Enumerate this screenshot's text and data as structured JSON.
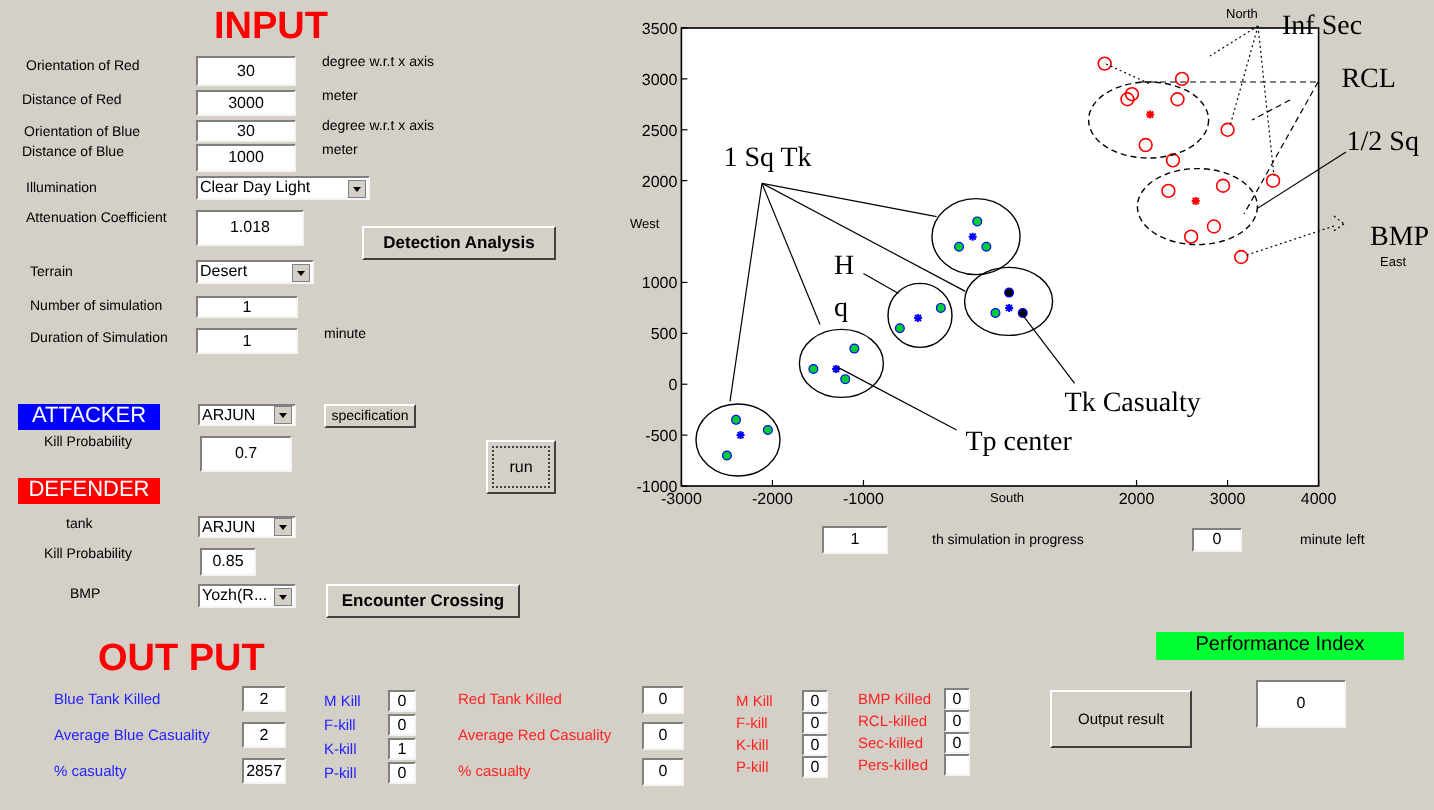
{
  "input": {
    "title": "INPUT",
    "fields": [
      {
        "kind": "edit",
        "label": "Orientation of Red",
        "value": "30",
        "unit": "degree w.r.t  x axis"
      },
      {
        "kind": "edit",
        "label": "Distance of Red",
        "value": "3000",
        "unit": "meter"
      },
      {
        "kind": "edit",
        "label": "Orientation of Blue",
        "value": "30",
        "unit": "degree w.r.t  x axis"
      },
      {
        "kind": "edit",
        "label": "Distance of Blue",
        "value": "1000",
        "unit": "meter"
      },
      {
        "kind": "dropdown",
        "label": "Illumination",
        "value": "Clear Day Light"
      },
      {
        "kind": "edit",
        "label": "Attenuation Coefficient",
        "value": "1.018"
      },
      {
        "kind": "dropdown",
        "label": "Terrain",
        "value": "Desert"
      },
      {
        "kind": "edit",
        "label": "Number of simulation",
        "value": "1"
      },
      {
        "kind": "edit",
        "label": "Duration of Simulation",
        "value": "1",
        "unit": "minute"
      }
    ],
    "detection_button": "Detection Analysis"
  },
  "attacker": {
    "label": "ATTACKER",
    "vehicle": "ARJUN",
    "spec_button": "specification",
    "kill_probability_label": "Kill Probability",
    "kill_probability": "0.7"
  },
  "run_button": "run",
  "defender": {
    "label": "DEFENDER",
    "tank_label": "tank",
    "tank": "ARJUN",
    "kill_probability_label": "Kill Probability",
    "kill_probability": "0.85",
    "bmp_label": "BMP",
    "bmp": "Yozh(R...",
    "encounter_button": "Encounter Crossing"
  },
  "plot": {
    "chart_data": {
      "type": "scatter",
      "title": "North",
      "xlabel": "South",
      "ylabel": "West",
      "xlim": [
        -3000,
        4000
      ],
      "ylim": [
        -1000,
        3500
      ],
      "xticks": [
        -3000,
        -2000,
        -1000,
        2000,
        3000,
        4000
      ],
      "yticks": [
        -1000,
        -500,
        0,
        500,
        1000,
        2000,
        2500,
        3000,
        3500
      ],
      "series": [
        {
          "color": "#00cc33",
          "x": [
            -2400,
            -2050,
            -2500,
            -1550,
            -1100,
            -1200,
            -600,
            -150,
            250,
            50,
            350,
            450
          ],
          "values": [
            -350,
            -450,
            -700,
            150,
            350,
            50,
            550,
            750,
            1600,
            1350,
            1350,
            700
          ]
        },
        {
          "marker": "cross",
          "color": "#0000ff",
          "x": [
            -2350,
            -1300,
            -400,
            200,
            600
          ],
          "values": [
            -500,
            150,
            650,
            1450,
            750
          ]
        },
        {
          "color": "#000000",
          "x": [
            600,
            750
          ],
          "values": [
            900,
            700
          ]
        },
        {
          "marker": "circle",
          "color": "#ff0000",
          "x": [
            1650,
            1950,
            1900,
            2450,
            2500,
            2100,
            2400,
            3000,
            3500,
            2350,
            2950,
            2850,
            2600,
            3150
          ],
          "values": [
            3150,
            2850,
            2800,
            2800,
            3000,
            2350,
            2200,
            2500,
            2000,
            1900,
            1950,
            1550,
            1450,
            1250
          ]
        },
        {
          "marker": "cross",
          "color": "#ff0000",
          "x": [
            2150,
            2650
          ],
          "values": [
            2650,
            1800
          ]
        }
      ],
      "annotations": [
        "1 Sq Tk",
        "H",
        "q",
        "Tk Casualty",
        "Tp center",
        "Inf Sec",
        "RCL",
        "1/2 Sq",
        "BMP",
        "East"
      ]
    }
  },
  "progress": {
    "simulation": "1",
    "simulation_text": "th simulation in progress",
    "minutes": "0",
    "minutes_text": "minute left"
  },
  "output": {
    "title": "OUT PUT",
    "blue": [
      {
        "label": "Blue Tank Killed",
        "value": "2"
      },
      {
        "label": "Average Blue Casuality",
        "value": "2"
      },
      {
        "label": "% casualty",
        "value": "2857"
      }
    ],
    "blue_kills": [
      {
        "label": "M Kill",
        "value": "0"
      },
      {
        "label": "F-kill",
        "value": "0"
      },
      {
        "label": "K-kill",
        "value": "1"
      },
      {
        "label": "P-kill",
        "value": "0"
      }
    ],
    "red": [
      {
        "label": "Red Tank Killed",
        "value": "0"
      },
      {
        "label": "Average Red Casuality",
        "value": "0"
      },
      {
        "label": "% casualty",
        "value": "0"
      }
    ],
    "red_kills": [
      {
        "label": "M Kill",
        "value": "0"
      },
      {
        "label": "F-kill",
        "value": "0"
      },
      {
        "label": "K-kill",
        "value": "0"
      },
      {
        "label": "P-kill",
        "value": "0"
      }
    ],
    "red_losses": [
      {
        "label": "BMP  Killed",
        "value": "0"
      },
      {
        "label": "RCL-killed",
        "value": "0"
      },
      {
        "label": "Sec-killed",
        "value": "0"
      },
      {
        "label": "Pers-killed"
      }
    ],
    "output_button": "Output result",
    "performance": {
      "label": "Performance Index",
      "value": "0"
    }
  }
}
